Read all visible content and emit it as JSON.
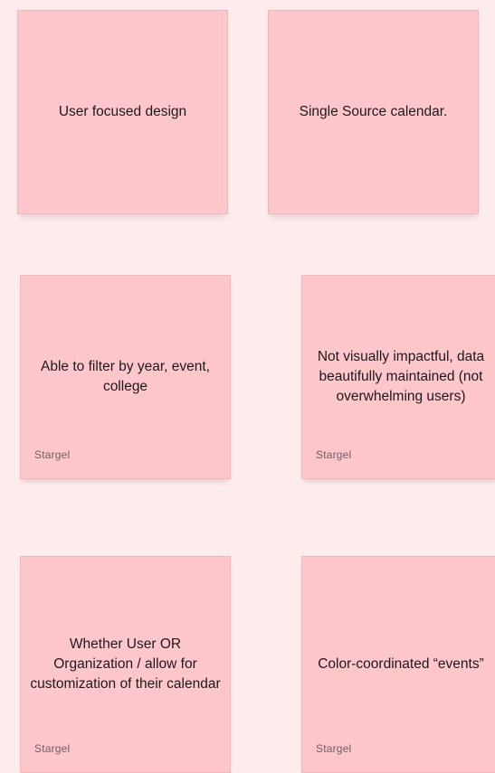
{
  "board": {
    "notes": [
      {
        "text": "User focused design",
        "author": ""
      },
      {
        "text": "Single Source calendar.",
        "author": ""
      },
      {
        "text": "Able to filter by year, event, college",
        "author": "Stargel"
      },
      {
        "text": "Not visually impactful, data beautifully maintained (not overwhelming users)",
        "author": "Stargel"
      },
      {
        "text": "Whether User OR Organization / allow for customization of their calendar",
        "author": "Stargel"
      },
      {
        "text": "Color-coordinated “events”",
        "author": "Stargel"
      }
    ]
  },
  "colors": {
    "background": "#fdeceb",
    "sticky_note": "#ffc7cc"
  }
}
